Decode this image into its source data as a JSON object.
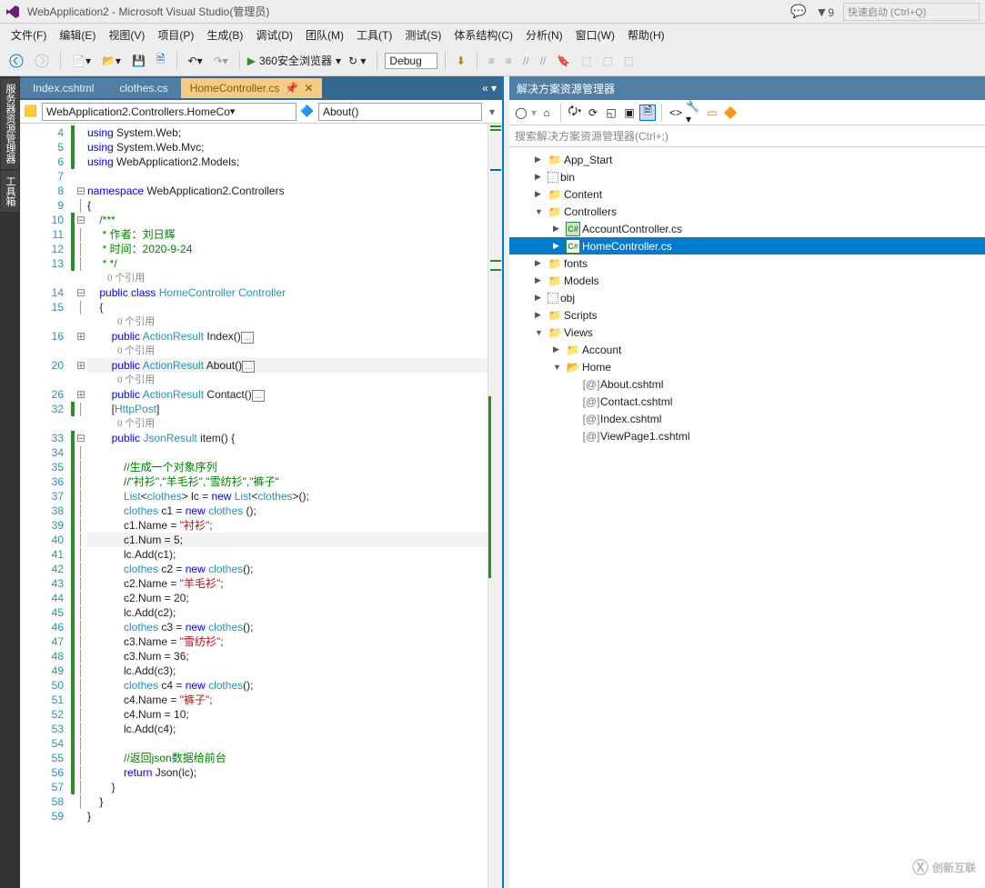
{
  "title": "WebApplication2 - Microsoft Visual Studio(管理员)",
  "quickLaunch": "快速启动 (Ctrl+Q)",
  "notifBadge": "9",
  "menu": [
    "文件(F)",
    "编辑(E)",
    "视图(V)",
    "项目(P)",
    "生成(B)",
    "调试(D)",
    "团队(M)",
    "工具(T)",
    "测试(S)",
    "体系结构(C)",
    "分析(N)",
    "窗口(W)",
    "帮助(H)"
  ],
  "toolbar": {
    "start": "360安全浏览器",
    "config": "Debug"
  },
  "leftRail": [
    "服务器资源管理器",
    "工具箱"
  ],
  "tabs": {
    "inactive": [
      "Index.cshtml",
      "clothes.cs"
    ],
    "active": "HomeController.cs"
  },
  "nav": {
    "scope": "WebApplication2.Controllers.HomeCo",
    "member": "About()"
  },
  "refText": "0 个引用",
  "code": {
    "lines": [
      {
        "n": 4,
        "g": 1,
        "t": "using System.Web;",
        "sp": [
          "k:using",
          " System.Web;"
        ]
      },
      {
        "n": 5,
        "g": 1,
        "t": "using System.Web.Mvc;",
        "sp": [
          "k:using",
          " System.Web.Mvc;"
        ]
      },
      {
        "n": 6,
        "g": 1,
        "t": "using WebApplication2.Models;",
        "sp": [
          "k:using",
          " WebApplication2.Models;"
        ]
      },
      {
        "n": 7,
        "g": 0,
        "t": ""
      },
      {
        "n": 8,
        "g": 0,
        "f": "-",
        "t": "namespace WebApplication2.Controllers",
        "sp": [
          "k:namespace",
          " WebApplication2.Controllers"
        ]
      },
      {
        "n": 9,
        "g": 0,
        "f": "|",
        "t": "{"
      },
      {
        "n": 10,
        "g": 1,
        "f": "-",
        "t": "    /***",
        "sp": [
          "c:    /***"
        ]
      },
      {
        "n": 11,
        "g": 1,
        "f": "|",
        "t": "     * 作者：刘日辉",
        "sp": [
          "c:     * 作者：刘日辉"
        ]
      },
      {
        "n": 12,
        "g": 1,
        "f": "|",
        "t": "     * 时间：2020-9-24",
        "sp": [
          "c:     * 时间：2020-9-24"
        ]
      },
      {
        "n": 13,
        "g": 1,
        "f": "|",
        "t": "     * */",
        "sp": [
          "c:     * */"
        ]
      },
      {
        "n": 0,
        "g": 0,
        "ref": 1,
        "t": "        0 个引用"
      },
      {
        "n": 14,
        "g": 0,
        "f": "-",
        "t": "    public class HomeController : Controller",
        "sp": [
          "    ",
          "k:public",
          " ",
          "k:class",
          " ",
          "t:HomeController",
          " : ",
          "t:Controller"
        ]
      },
      {
        "n": 15,
        "g": 0,
        "f": "|",
        "t": "    {"
      },
      {
        "n": 0,
        "g": 0,
        "ref": 1,
        "t": "            0 个引用"
      },
      {
        "n": 16,
        "g": 0,
        "f": "+",
        "t": "        public ActionResult Index()",
        "sp": [
          "        ",
          "k:public",
          " ",
          "t:ActionResult",
          " Index()"
        ],
        "box": 1
      },
      {
        "n": 0,
        "g": 0,
        "ref": 1,
        "t": "            0 个引用"
      },
      {
        "n": 20,
        "g": 0,
        "f": "+",
        "hl": 1,
        "t": "        public ActionResult About()",
        "sp": [
          "        ",
          "k:public",
          " ",
          "t:ActionResult",
          " About()"
        ],
        "box": 1
      },
      {
        "n": 0,
        "g": 0,
        "ref": 1,
        "t": "            0 个引用"
      },
      {
        "n": 26,
        "g": 0,
        "f": "+",
        "t": "        public ActionResult Contact()",
        "sp": [
          "        ",
          "k:public",
          " ",
          "t:ActionResult",
          " Contact()"
        ],
        "box": 1
      },
      {
        "n": 32,
        "g": 1,
        "f": "|",
        "t": "        [HttpPost]",
        "sp": [
          "        [",
          "t:HttpPost",
          "]"
        ]
      },
      {
        "n": 0,
        "g": 0,
        "ref": 1,
        "t": "            0 个引用"
      },
      {
        "n": 33,
        "g": 1,
        "f": "-",
        "t": "        public JsonResult item() {",
        "sp": [
          "        ",
          "k:public",
          " ",
          "t:JsonResult",
          " item() {"
        ]
      },
      {
        "n": 34,
        "g": 1,
        "f": "|",
        "t": ""
      },
      {
        "n": 35,
        "g": 1,
        "f": "|",
        "t": "            //生成一个对象序列",
        "sp": [
          "c:            //生成一个对象序列"
        ]
      },
      {
        "n": 36,
        "g": 1,
        "f": "|",
        "t": "            //\"衬衫\",\"羊毛衫\",\"雪纺衫\",\"裤子\"",
        "sp": [
          "c:            //\"衬衫\",\"羊毛衫\",\"雪纺衫\",\"裤子\""
        ]
      },
      {
        "n": 37,
        "g": 1,
        "f": "|",
        "t": "            List<clothes> lc = new List<clothes>();",
        "sp": [
          "            ",
          "t:List",
          "<",
          "t:clothes",
          "> lc = ",
          "k:new",
          " ",
          "t:List",
          "<",
          "t:clothes",
          ">();"
        ]
      },
      {
        "n": 38,
        "g": 1,
        "f": "|",
        "t": "            clothes c1 = new clothes ();",
        "sp": [
          "            ",
          "t:clothes",
          " c1 = ",
          "k:new",
          " ",
          "t:clothes",
          " ();"
        ]
      },
      {
        "n": 39,
        "g": 1,
        "f": "|",
        "t": "            c1.Name = \"衬衫\";",
        "sp": [
          "            c1.Name = ",
          "s:\"衬衫\"",
          ";"
        ]
      },
      {
        "n": 40,
        "g": 1,
        "f": "|",
        "hl": 1,
        "t": "            c1.Num = 5;",
        "sp": [
          "            c1.Num = 5;"
        ]
      },
      {
        "n": 41,
        "g": 1,
        "f": "|",
        "t": "            lc.Add(c1);",
        "sp": [
          "            lc.Add(c1);"
        ]
      },
      {
        "n": 42,
        "g": 1,
        "f": "|",
        "t": "            clothes c2 = new clothes();",
        "sp": [
          "            ",
          "t:clothes",
          " c2 = ",
          "k:new",
          " ",
          "t:clothes",
          "();"
        ]
      },
      {
        "n": 43,
        "g": 1,
        "f": "|",
        "t": "            c2.Name = \"羊毛衫\";",
        "sp": [
          "            c2.Name = ",
          "s:\"羊毛衫\"",
          ";"
        ]
      },
      {
        "n": 44,
        "g": 1,
        "f": "|",
        "t": "            c2.Num = 20;",
        "sp": [
          "            c2.Num = 20;"
        ]
      },
      {
        "n": 45,
        "g": 1,
        "f": "|",
        "t": "            lc.Add(c2);",
        "sp": [
          "            lc.Add(c2);"
        ]
      },
      {
        "n": 46,
        "g": 1,
        "f": "|",
        "t": "            clothes c3 = new clothes();",
        "sp": [
          "            ",
          "t:clothes",
          " c3 = ",
          "k:new",
          " ",
          "t:clothes",
          "();"
        ]
      },
      {
        "n": 47,
        "g": 1,
        "f": "|",
        "t": "            c3.Name = \"雪纺衫\";",
        "sp": [
          "            c3.Name = ",
          "s:\"雪纺衫\"",
          ";"
        ]
      },
      {
        "n": 48,
        "g": 1,
        "f": "|",
        "t": "            c3.Num = 36;",
        "sp": [
          "            c3.Num = 36;"
        ]
      },
      {
        "n": 49,
        "g": 1,
        "f": "|",
        "t": "            lc.Add(c3);",
        "sp": [
          "            lc.Add(c3);"
        ]
      },
      {
        "n": 50,
        "g": 1,
        "f": "|",
        "t": "            clothes c4 = new clothes();",
        "sp": [
          "            ",
          "t:clothes",
          " c4 = ",
          "k:new",
          " ",
          "t:clothes",
          "();"
        ]
      },
      {
        "n": 51,
        "g": 1,
        "f": "|",
        "t": "            c4.Name = \"裤子\";",
        "sp": [
          "            c4.Name = ",
          "s:\"裤子\"",
          ";"
        ]
      },
      {
        "n": 52,
        "g": 1,
        "f": "|",
        "t": "            c4.Num = 10;",
        "sp": [
          "            c4.Num = 10;"
        ]
      },
      {
        "n": 53,
        "g": 1,
        "f": "|",
        "t": "            lc.Add(c4);",
        "sp": [
          "            lc.Add(c4);"
        ]
      },
      {
        "n": 54,
        "g": 1,
        "f": "|",
        "t": ""
      },
      {
        "n": 55,
        "g": 1,
        "f": "|",
        "t": "            //返回json数据给前台",
        "sp": [
          "c:            //返回json数据给前台"
        ]
      },
      {
        "n": 56,
        "g": 1,
        "f": "|",
        "t": "            return Json(lc);",
        "sp": [
          "            ",
          "k:return",
          " Json(lc);"
        ]
      },
      {
        "n": 57,
        "g": 1,
        "f": "|",
        "t": "        }"
      },
      {
        "n": 58,
        "g": 0,
        "f": "|",
        "t": "    }"
      },
      {
        "n": 59,
        "g": 0,
        "t": "}"
      }
    ]
  },
  "solutionPanel": {
    "title": "解决方案资源管理器",
    "search": "搜索解决方案资源管理器(Ctrl+;)",
    "tree": [
      {
        "ind": 1,
        "arr": "▶",
        "ico": "folder",
        "lbl": "App_Start"
      },
      {
        "ind": 1,
        "arr": "▶",
        "ico": "dots",
        "lbl": "bin"
      },
      {
        "ind": 1,
        "arr": "▶",
        "ico": "folder",
        "lbl": "Content"
      },
      {
        "ind": 1,
        "arr": "▼",
        "ico": "folder",
        "lbl": "Controllers"
      },
      {
        "ind": 2,
        "arr": "▶",
        "ico": "cs",
        "lbl": "AccountController.cs"
      },
      {
        "ind": 2,
        "arr": "▶",
        "ico": "cs",
        "lbl": "HomeController.cs",
        "sel": 1
      },
      {
        "ind": 1,
        "arr": "▶",
        "ico": "folder",
        "lbl": "fonts"
      },
      {
        "ind": 1,
        "arr": "▶",
        "ico": "folder",
        "lbl": "Models"
      },
      {
        "ind": 1,
        "arr": "▶",
        "ico": "dots",
        "lbl": "obj"
      },
      {
        "ind": 1,
        "arr": "▶",
        "ico": "folder",
        "lbl": "Scripts"
      },
      {
        "ind": 1,
        "arr": "▼",
        "ico": "folder",
        "lbl": "Views"
      },
      {
        "ind": 2,
        "arr": "▶",
        "ico": "folder",
        "lbl": "Account"
      },
      {
        "ind": 2,
        "arr": "▼",
        "ico": "folder-open",
        "lbl": "Home"
      },
      {
        "ind": 3,
        "arr": "",
        "ico": "at",
        "lbl": "About.cshtml"
      },
      {
        "ind": 3,
        "arr": "",
        "ico": "at",
        "lbl": "Contact.cshtml"
      },
      {
        "ind": 3,
        "arr": "",
        "ico": "at",
        "lbl": "Index.cshtml"
      },
      {
        "ind": 3,
        "arr": "",
        "ico": "at",
        "lbl": "ViewPage1.cshtml"
      }
    ]
  },
  "watermark": "创新互联"
}
